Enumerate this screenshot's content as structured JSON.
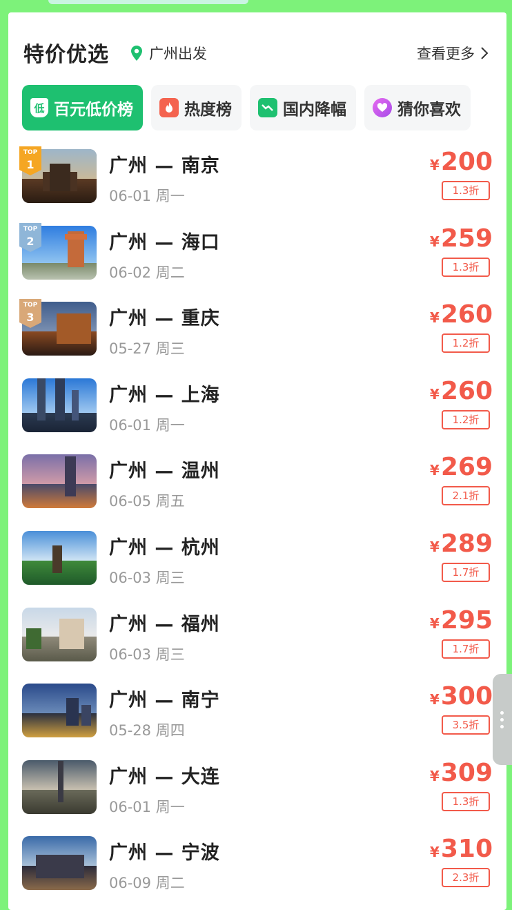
{
  "header": {
    "title": "特价优选",
    "location": "广州出发",
    "more": "查看更多"
  },
  "tabs": [
    {
      "label": "百元低价榜",
      "icon": "low-price-icon",
      "icon_text": "低",
      "active": true
    },
    {
      "label": "热度榜",
      "icon": "fire-icon",
      "active": false
    },
    {
      "label": "国内降幅",
      "icon": "trend-down-icon",
      "active": false
    },
    {
      "label": "猜你喜欢",
      "icon": "heart-icon",
      "active": false
    }
  ],
  "flights": [
    {
      "route": "广州 — 南京",
      "date": "06-01 周一",
      "currency": "¥",
      "price": "200",
      "discount": "1.3折",
      "rank": "1"
    },
    {
      "route": "广州 — 海口",
      "date": "06-02 周二",
      "currency": "¥",
      "price": "259",
      "discount": "1.3折",
      "rank": "2"
    },
    {
      "route": "广州 — 重庆",
      "date": "05-27 周三",
      "currency": "¥",
      "price": "260",
      "discount": "1.2折",
      "rank": "3"
    },
    {
      "route": "广州 — 上海",
      "date": "06-01 周一",
      "currency": "¥",
      "price": "260",
      "discount": "1.2折"
    },
    {
      "route": "广州 — 温州",
      "date": "06-05 周五",
      "currency": "¥",
      "price": "269",
      "discount": "2.1折"
    },
    {
      "route": "广州 — 杭州",
      "date": "06-03 周三",
      "currency": "¥",
      "price": "289",
      "discount": "1.7折"
    },
    {
      "route": "广州 — 福州",
      "date": "06-03 周三",
      "currency": "¥",
      "price": "295",
      "discount": "1.7折"
    },
    {
      "route": "广州 — 南宁",
      "date": "05-28 周四",
      "currency": "¥",
      "price": "300",
      "discount": "3.5折"
    },
    {
      "route": "广州 — 大连",
      "date": "06-01 周一",
      "currency": "¥",
      "price": "309",
      "discount": "1.3折"
    },
    {
      "route": "广州 — 宁波",
      "date": "06-09 周二",
      "currency": "¥",
      "price": "310",
      "discount": "2.3折"
    }
  ],
  "badge_text": "TOP",
  "colors": {
    "accent": "#1ec070",
    "price": "#f25a4a",
    "frame": "#7df27a"
  }
}
